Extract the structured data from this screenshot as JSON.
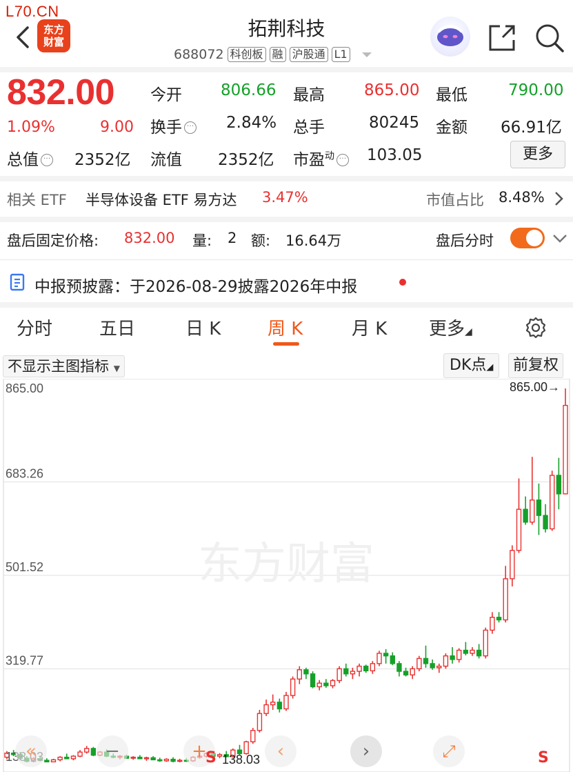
{
  "site_tag": "L70.CN",
  "header": {
    "title": "拓荆科技",
    "code": "688072",
    "badges": [
      "科创板",
      "融",
      "沪股通",
      "L1"
    ],
    "logo_text_1": "东方",
    "logo_text_2": "财富",
    "icons": [
      "back-icon",
      "share-icon",
      "search-icon",
      "robot-avatar"
    ]
  },
  "quote": {
    "price": "832.00",
    "change_pct": "1.09%",
    "change_abs": "9.00",
    "open_label": "今开",
    "open": "806.66",
    "high_label": "最高",
    "high": "865.00",
    "low_label": "最低",
    "low": "790.00",
    "turnover_label": "换手",
    "turnover": "2.84%",
    "volume_label": "总手",
    "volume": "80245",
    "amount_label": "金额",
    "amount": "66.91亿",
    "total_cap_label": "总值",
    "total_cap": "2352亿",
    "float_cap_label": "流值",
    "float_cap": "2352亿",
    "pe_label": "市盈",
    "pe_sup": "动",
    "pe": "103.05",
    "more_label": "更多"
  },
  "etf": {
    "label": "相关 ETF",
    "name": "半导体设备 ETF 易方达",
    "pct": "3.47%",
    "share_label": "市值占比",
    "share": "8.48%"
  },
  "after_hours": {
    "label": "盘后固定价格:",
    "price": "832.00",
    "vol_label": "量:",
    "vol": "2",
    "amt_label": "额:",
    "amt": "16.64万",
    "timeshare_label": "盘后分时"
  },
  "disclosure": {
    "text": "中报预披露：于2026-08-29披露2026年中报"
  },
  "tabs": [
    "分时",
    "五日",
    "日 K",
    "周 K",
    "月 K",
    "更多"
  ],
  "active_tab": "周 K",
  "chart_toolbar": {
    "indicator": "不显示主图指标",
    "dk": "DK点",
    "adjust": "前复权"
  },
  "watermark": "东方财富",
  "colors": {
    "up": "#e93030",
    "down": "#16a02a",
    "accent": "#f0581a"
  },
  "chart_data": {
    "type": "candlestick",
    "y_ticks": [
      "865.00",
      "683.26",
      "501.52",
      "319.77",
      "138.03"
    ],
    "ylim": [
      138.03,
      865.0
    ],
    "max_label": "865.00→",
    "min_label": "138.03",
    "candles": [
      {
        "o": 148,
        "h": 160,
        "l": 144,
        "c": 156
      },
      {
        "o": 156,
        "h": 162,
        "l": 150,
        "c": 153
      },
      {
        "o": 153,
        "h": 158,
        "l": 142,
        "c": 146
      },
      {
        "o": 146,
        "h": 150,
        "l": 138,
        "c": 140
      },
      {
        "o": 140,
        "h": 148,
        "l": 138,
        "c": 145
      },
      {
        "o": 145,
        "h": 150,
        "l": 140,
        "c": 142
      },
      {
        "o": 142,
        "h": 146,
        "l": 138,
        "c": 139
      },
      {
        "o": 139,
        "h": 145,
        "l": 138,
        "c": 143
      },
      {
        "o": 143,
        "h": 150,
        "l": 140,
        "c": 148
      },
      {
        "o": 148,
        "h": 155,
        "l": 144,
        "c": 145
      },
      {
        "o": 145,
        "h": 152,
        "l": 142,
        "c": 150
      },
      {
        "o": 150,
        "h": 162,
        "l": 148,
        "c": 158
      },
      {
        "o": 158,
        "h": 170,
        "l": 155,
        "c": 165
      },
      {
        "o": 165,
        "h": 168,
        "l": 150,
        "c": 152
      },
      {
        "o": 152,
        "h": 160,
        "l": 150,
        "c": 158
      },
      {
        "o": 158,
        "h": 163,
        "l": 148,
        "c": 150
      },
      {
        "o": 150,
        "h": 155,
        "l": 146,
        "c": 148
      },
      {
        "o": 148,
        "h": 152,
        "l": 144,
        "c": 150
      },
      {
        "o": 150,
        "h": 153,
        "l": 145,
        "c": 146
      },
      {
        "o": 146,
        "h": 150,
        "l": 143,
        "c": 148
      },
      {
        "o": 148,
        "h": 152,
        "l": 144,
        "c": 145
      },
      {
        "o": 145,
        "h": 149,
        "l": 141,
        "c": 147
      },
      {
        "o": 147,
        "h": 150,
        "l": 142,
        "c": 143
      },
      {
        "o": 143,
        "h": 147,
        "l": 139,
        "c": 141
      },
      {
        "o": 141,
        "h": 146,
        "l": 139,
        "c": 144
      },
      {
        "o": 144,
        "h": 148,
        "l": 138,
        "c": 140
      },
      {
        "o": 140,
        "h": 145,
        "l": 138,
        "c": 142
      },
      {
        "o": 142,
        "h": 146,
        "l": 139,
        "c": 141
      },
      {
        "o": 141,
        "h": 150,
        "l": 139,
        "c": 148
      },
      {
        "o": 148,
        "h": 156,
        "l": 145,
        "c": 150
      },
      {
        "o": 150,
        "h": 158,
        "l": 147,
        "c": 155
      },
      {
        "o": 155,
        "h": 160,
        "l": 148,
        "c": 150
      },
      {
        "o": 150,
        "h": 156,
        "l": 146,
        "c": 153
      },
      {
        "o": 153,
        "h": 160,
        "l": 148,
        "c": 149
      },
      {
        "o": 149,
        "h": 165,
        "l": 147,
        "c": 162
      },
      {
        "o": 162,
        "h": 172,
        "l": 152,
        "c": 155
      },
      {
        "o": 155,
        "h": 180,
        "l": 153,
        "c": 178
      },
      {
        "o": 178,
        "h": 205,
        "l": 174,
        "c": 200
      },
      {
        "o": 200,
        "h": 240,
        "l": 196,
        "c": 233
      },
      {
        "o": 233,
        "h": 260,
        "l": 228,
        "c": 250
      },
      {
        "o": 250,
        "h": 270,
        "l": 240,
        "c": 255
      },
      {
        "o": 255,
        "h": 262,
        "l": 235,
        "c": 242
      },
      {
        "o": 242,
        "h": 275,
        "l": 238,
        "c": 268
      },
      {
        "o": 268,
        "h": 305,
        "l": 262,
        "c": 300
      },
      {
        "o": 300,
        "h": 325,
        "l": 290,
        "c": 318
      },
      {
        "o": 318,
        "h": 322,
        "l": 300,
        "c": 310
      },
      {
        "o": 310,
        "h": 315,
        "l": 282,
        "c": 285
      },
      {
        "o": 285,
        "h": 298,
        "l": 278,
        "c": 292
      },
      {
        "o": 292,
        "h": 300,
        "l": 283,
        "c": 287
      },
      {
        "o": 287,
        "h": 300,
        "l": 282,
        "c": 297
      },
      {
        "o": 297,
        "h": 325,
        "l": 292,
        "c": 320
      },
      {
        "o": 320,
        "h": 330,
        "l": 305,
        "c": 310
      },
      {
        "o": 310,
        "h": 322,
        "l": 300,
        "c": 315
      },
      {
        "o": 315,
        "h": 330,
        "l": 305,
        "c": 325
      },
      {
        "o": 325,
        "h": 328,
        "l": 312,
        "c": 316
      },
      {
        "o": 316,
        "h": 335,
        "l": 310,
        "c": 330
      },
      {
        "o": 330,
        "h": 355,
        "l": 325,
        "c": 350
      },
      {
        "o": 350,
        "h": 358,
        "l": 330,
        "c": 345
      },
      {
        "o": 345,
        "h": 352,
        "l": 327,
        "c": 330
      },
      {
        "o": 330,
        "h": 335,
        "l": 305,
        "c": 315
      },
      {
        "o": 315,
        "h": 322,
        "l": 305,
        "c": 308
      },
      {
        "o": 308,
        "h": 325,
        "l": 300,
        "c": 320
      },
      {
        "o": 320,
        "h": 345,
        "l": 315,
        "c": 340
      },
      {
        "o": 340,
        "h": 365,
        "l": 322,
        "c": 330
      },
      {
        "o": 330,
        "h": 338,
        "l": 318,
        "c": 322
      },
      {
        "o": 322,
        "h": 330,
        "l": 312,
        "c": 325
      },
      {
        "o": 325,
        "h": 350,
        "l": 320,
        "c": 345
      },
      {
        "o": 345,
        "h": 362,
        "l": 330,
        "c": 338
      },
      {
        "o": 338,
        "h": 360,
        "l": 332,
        "c": 356
      },
      {
        "o": 356,
        "h": 372,
        "l": 346,
        "c": 350
      },
      {
        "o": 350,
        "h": 362,
        "l": 345,
        "c": 356
      },
      {
        "o": 356,
        "h": 368,
        "l": 340,
        "c": 345
      },
      {
        "o": 345,
        "h": 400,
        "l": 340,
        "c": 395
      },
      {
        "o": 395,
        "h": 430,
        "l": 388,
        "c": 420
      },
      {
        "o": 420,
        "h": 430,
        "l": 410,
        "c": 415
      },
      {
        "o": 415,
        "h": 520,
        "l": 410,
        "c": 495
      },
      {
        "o": 495,
        "h": 560,
        "l": 480,
        "c": 550
      },
      {
        "o": 550,
        "h": 690,
        "l": 545,
        "c": 630
      },
      {
        "o": 630,
        "h": 655,
        "l": 600,
        "c": 605
      },
      {
        "o": 605,
        "h": 732,
        "l": 600,
        "c": 648
      },
      {
        "o": 648,
        "h": 680,
        "l": 580,
        "c": 618
      },
      {
        "o": 618,
        "h": 640,
        "l": 585,
        "c": 592
      },
      {
        "o": 592,
        "h": 705,
        "l": 588,
        "c": 696
      },
      {
        "o": 696,
        "h": 730,
        "l": 630,
        "c": 660
      },
      {
        "o": 660,
        "h": 865,
        "l": 660,
        "c": 832
      }
    ]
  },
  "fab": {
    "left_arrows": "«",
    "plus": "+",
    "next": "›",
    "expand": "⤢",
    "s_label": "S"
  }
}
